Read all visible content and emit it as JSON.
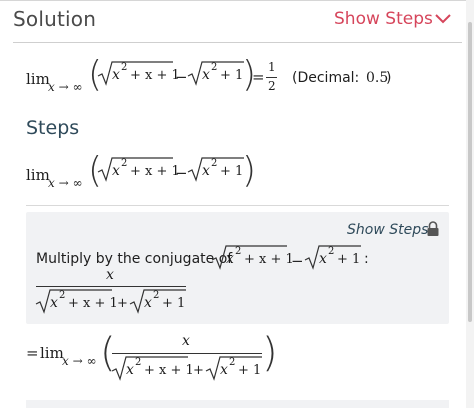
{
  "header": {
    "title": "Solution",
    "show_steps": "Show Steps"
  },
  "result": {
    "lim": "lim",
    "sub": "x → ∞",
    "expr_inner_a": "x",
    "expr_inner_a_rest": "+ x + 1",
    "minus": "−",
    "expr_inner_b": "x",
    "expr_inner_b_rest": "+ 1",
    "sup": "2",
    "equals": "=",
    "frac_num": "1",
    "frac_den": "2",
    "decimal_label": "(Decimal:",
    "decimal_value": "0.5",
    "decimal_close": ")"
  },
  "steps": {
    "title": "Steps",
    "card": {
      "show_steps": "Show Steps",
      "multiply_text": "Multiply by the conjugate of",
      "colon": ":",
      "frac_num": "x",
      "plus": "+"
    },
    "final": {
      "equals": "="
    }
  },
  "colors": {
    "accent": "#d6455b",
    "steps_title": "#2f4a5a",
    "card_bg": "#f1f2f4"
  },
  "icons": {
    "chevron": "chevron-down-icon",
    "lock": "lock-icon"
  }
}
